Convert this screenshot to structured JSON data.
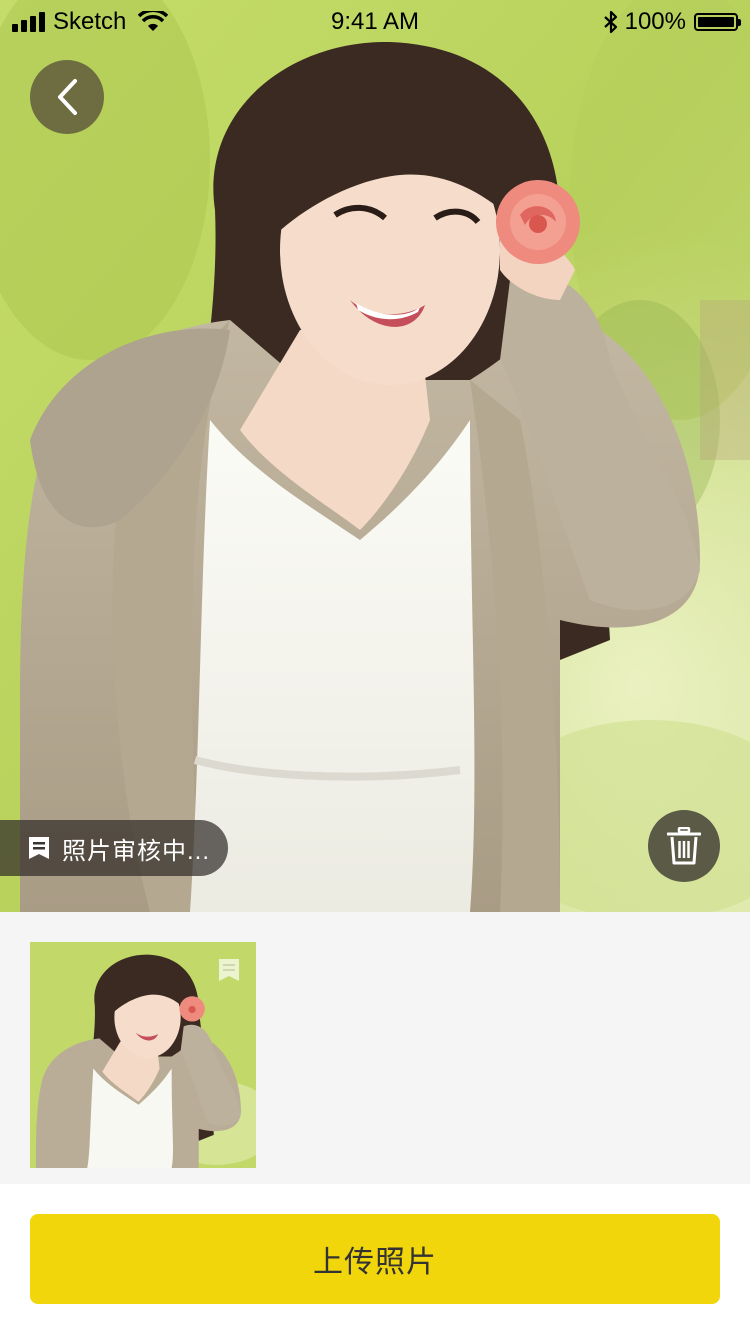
{
  "status_bar": {
    "carrier": "Sketch",
    "time": "9:41 AM",
    "battery_percent": "100%",
    "icons": [
      "signal-icon",
      "wifi-icon",
      "bluetooth-icon",
      "battery-icon"
    ]
  },
  "navigation": {
    "back_icon": "chevron-left-icon"
  },
  "photo": {
    "review_status": "照片审核中...",
    "review_icon": "flag-icon",
    "delete_icon": "trash-icon"
  },
  "thumbnails": [
    {
      "badge_icon": "flag-icon"
    }
  ],
  "actions": {
    "upload_label": "上传照片"
  },
  "colors": {
    "accent": "#f0d60a",
    "strip_background": "#f5f5f5",
    "overlay_dark": "#3c3732"
  }
}
